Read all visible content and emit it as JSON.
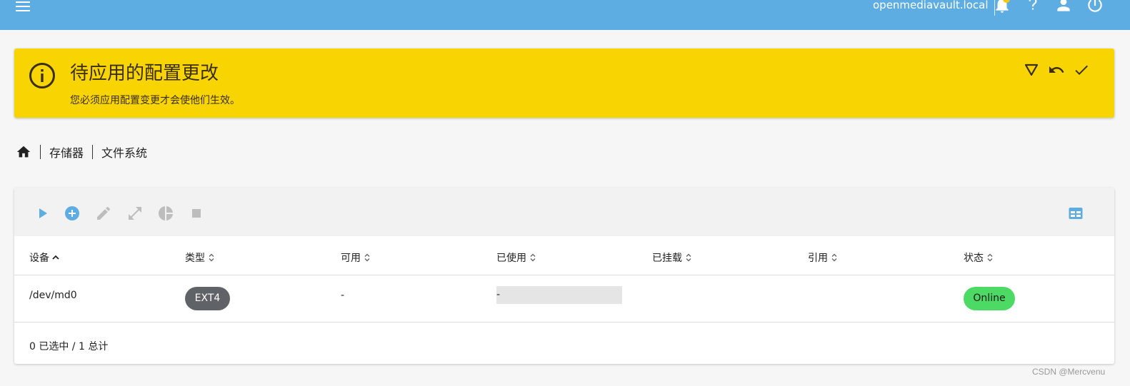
{
  "topbar": {
    "hostname": "openmediavault.local",
    "icons": [
      "menu-icon",
      "bell-icon",
      "help-icon",
      "user-icon",
      "power-icon"
    ],
    "color": "#5dade2"
  },
  "banner": {
    "title": "待应用的配置更改",
    "subtitle": "您必须应用配置变更才会使他们生效。",
    "color": "#f8d502",
    "actions": [
      "filter-icon",
      "undo-icon",
      "check-icon"
    ]
  },
  "breadcrumb": {
    "items": [
      "存储器",
      "文件系统"
    ]
  },
  "toolbar": {
    "icons": [
      "play-icon",
      "add-circle-icon",
      "edit-icon",
      "expand-icon",
      "pie-chart-icon",
      "stop-icon",
      "table-view-icon"
    ]
  },
  "table": {
    "columns": [
      "设备",
      "类型",
      "可用",
      "已使用",
      "已挂载",
      "引用",
      "状态"
    ],
    "rows": [
      {
        "device": "/dev/md0",
        "type": "EXT4",
        "available": "-",
        "used": "-",
        "mounted": "",
        "referenced": "",
        "status": "Online"
      }
    ],
    "footer": "0 已选中 / 1 总计"
  },
  "watermark": "CSDN @Mercvenu"
}
